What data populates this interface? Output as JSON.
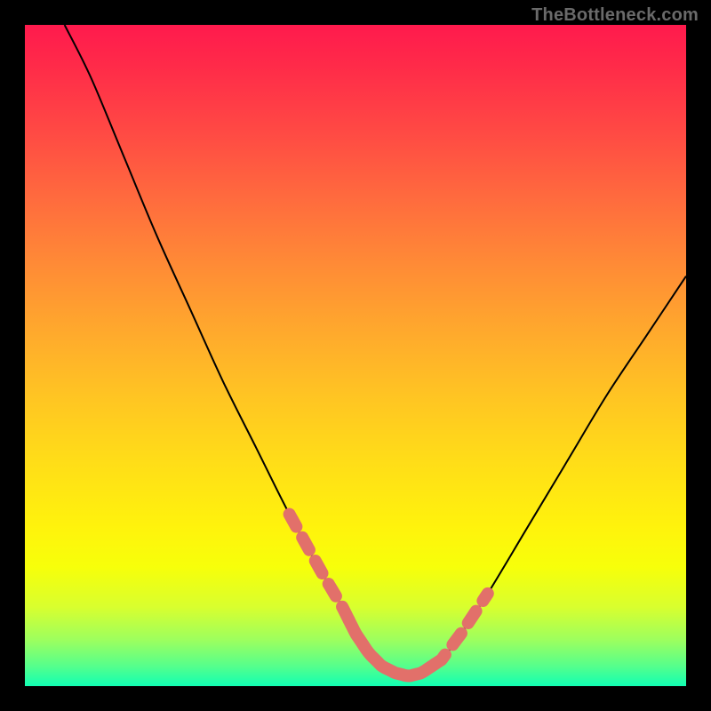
{
  "watermark": "TheBottleneck.com",
  "chart_data": {
    "type": "line",
    "title": "",
    "xlabel": "",
    "ylabel": "",
    "xlim": [
      0,
      100
    ],
    "ylim": [
      0,
      100
    ],
    "grid": false,
    "legend": false,
    "series": [
      {
        "name": "bottleneck-curve",
        "x": [
          6,
          10,
          15,
          20,
          25,
          30,
          35,
          40,
          45,
          48,
          50,
          52,
          54,
          56,
          58,
          60,
          63,
          66,
          70,
          76,
          82,
          88,
          94,
          100
        ],
        "y": [
          100,
          92,
          80,
          68,
          57,
          46,
          36,
          26,
          17,
          12,
          8,
          5,
          3,
          2,
          1.5,
          2,
          4,
          8,
          14,
          24,
          34,
          44,
          53,
          62
        ]
      }
    ],
    "highlights": [
      {
        "name": "left-descent-dash",
        "x_range": [
          40,
          49
        ],
        "style": "dashed"
      },
      {
        "name": "trough-solid",
        "x_range": [
          49,
          62
        ],
        "style": "solid"
      },
      {
        "name": "right-ascent-dash",
        "x_range": [
          62,
          70
        ],
        "style": "dashed"
      },
      {
        "name": "right-gap-after",
        "x_range": [
          66,
          68
        ],
        "style": "gap"
      }
    ],
    "gradient_stops": [
      {
        "pos": 0,
        "color": "#ff1a4d"
      },
      {
        "pos": 10,
        "color": "#ff2f48"
      },
      {
        "pos": 25,
        "color": "#ff6a3e"
      },
      {
        "pos": 40,
        "color": "#ff9a31"
      },
      {
        "pos": 55,
        "color": "#ffc623"
      },
      {
        "pos": 70,
        "color": "#ffe812"
      },
      {
        "pos": 82,
        "color": "#f2ff12"
      },
      {
        "pos": 92,
        "color": "#a4ff5a"
      },
      {
        "pos": 100,
        "color": "#11ffb3"
      }
    ]
  }
}
